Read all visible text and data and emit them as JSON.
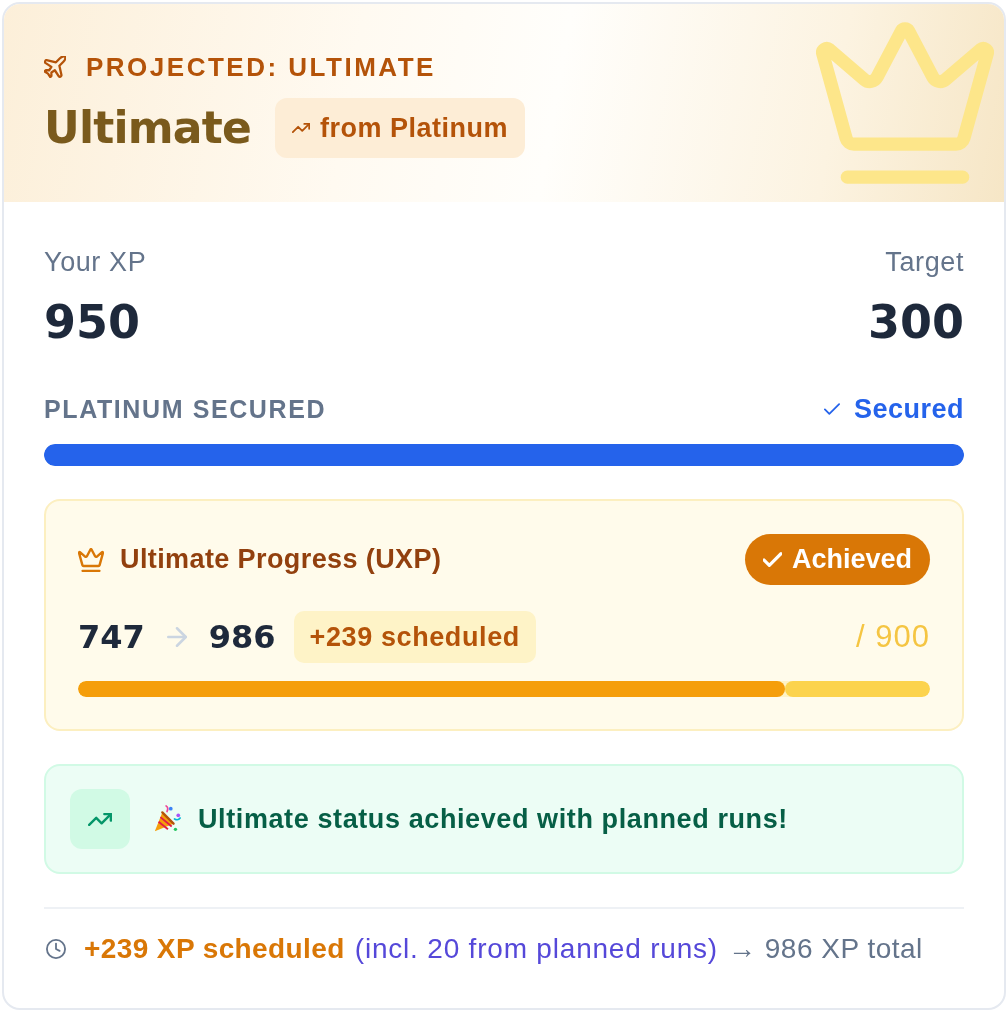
{
  "header": {
    "eyebrow": "PROJECTED: ULTIMATE",
    "tier": "Ultimate",
    "change_badge": "from Platinum"
  },
  "xp": {
    "your_label": "Your XP",
    "your_value": "950",
    "target_label": "Target",
    "target_value": "300"
  },
  "secured": {
    "label": "PLATINUM SECURED",
    "status": "Secured",
    "level": 1
  },
  "uxp": {
    "title": "Ultimate Progress (UXP)",
    "status": "Achieved",
    "achieved": true,
    "current": "747",
    "projected": "986",
    "scheduled": "+239 scheduled",
    "max": "/ 900",
    "segments": [
      {
        "kind": "current",
        "level": 0.83
      },
      {
        "kind": "scheduled",
        "level": 0.17
      }
    ]
  },
  "banner": {
    "message": "Ultimate status achieved with planned runs!"
  },
  "footer": {
    "scheduled": "+239 XP scheduled",
    "planned": "(incl. 20 from planned runs)",
    "total": "→ 986 XP total"
  }
}
